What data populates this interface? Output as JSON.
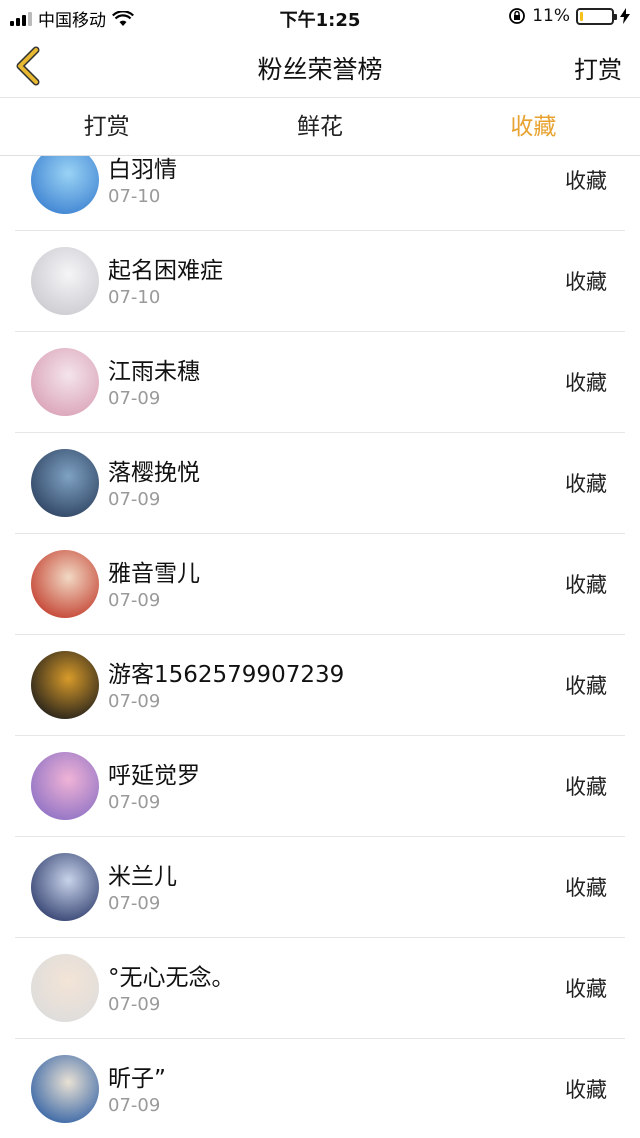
{
  "status": {
    "carrier": "中国移动",
    "time": "下午1:25",
    "battery_pct": "11%",
    "battery_level": 0.11
  },
  "nav": {
    "title": "粉丝荣誉榜",
    "action": "打赏"
  },
  "tabs": [
    {
      "label": "打赏",
      "active": false
    },
    {
      "label": "鲜花",
      "active": false
    },
    {
      "label": "收藏",
      "active": true
    }
  ],
  "rows": [
    {
      "name": "白羽情",
      "date": "07-10",
      "kind": "收藏",
      "colors": [
        "#3a7fd0",
        "#9ad3f5"
      ]
    },
    {
      "name": "起名困难症",
      "date": "07-10",
      "kind": "收藏",
      "colors": [
        "#c9c9cf",
        "#f5f5f7"
      ]
    },
    {
      "name": "江雨未穗",
      "date": "07-09",
      "kind": "收藏",
      "colors": [
        "#d9a0b4",
        "#f4e4ec"
      ]
    },
    {
      "name": "落樱挽悦",
      "date": "07-09",
      "kind": "收藏",
      "colors": [
        "#2b3f5e",
        "#7fa2c3"
      ]
    },
    {
      "name": "雅音雪儿",
      "date": "07-09",
      "kind": "收藏",
      "colors": [
        "#c23a2a",
        "#f1d9c4"
      ]
    },
    {
      "name": "游客1562579907239",
      "date": "07-09",
      "kind": "收藏",
      "colors": [
        "#1a1a1a",
        "#d89b2a"
      ]
    },
    {
      "name": "呼延觉罗",
      "date": "07-09",
      "kind": "收藏",
      "colors": [
        "#8a6fc4",
        "#f0b3d6"
      ]
    },
    {
      "name": "米兰儿",
      "date": "07-09",
      "kind": "收藏",
      "colors": [
        "#2c3a6a",
        "#c8d3ea"
      ]
    },
    {
      "name": "°无心无念。",
      "date": "07-09",
      "kind": "收藏",
      "colors": [
        "#dcdcdc",
        "#f3e4d6"
      ]
    },
    {
      "name": "昕子”",
      "date": "07-09",
      "kind": "收藏",
      "colors": [
        "#2d5ea3",
        "#e9e1d4"
      ]
    }
  ],
  "colors": {
    "accent": "#e8a230",
    "back_arrow": "#e8b830"
  }
}
